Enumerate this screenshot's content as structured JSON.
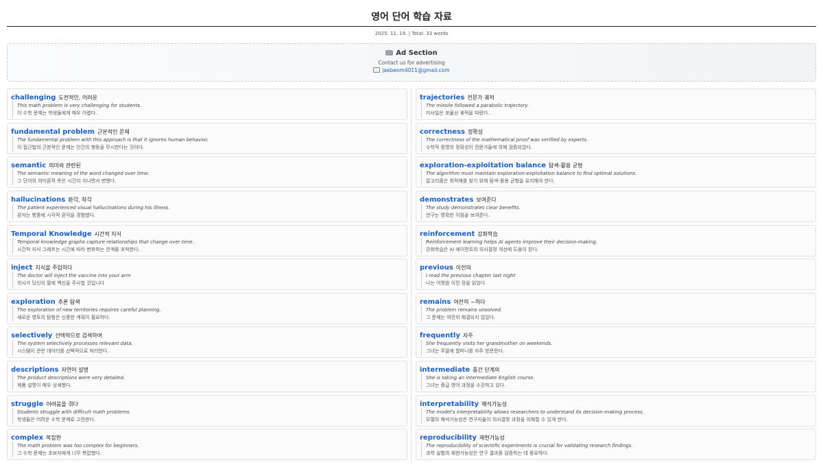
{
  "header": {
    "title": "영어 단어 학습 자료",
    "date": "2025. 11. 19.",
    "total": "Total: 33 words"
  },
  "ad": {
    "title": "Ad Section",
    "contact": "Contact us for advertising",
    "email": "jaebeom4011@gmail.com"
  },
  "left": [
    {
      "word": "challenging",
      "meaning": "도전적인, 어려운",
      "en": "This math problem is very challenging for students.",
      "ko": "이 수학 문제는 학생들에게 매우 어렵다."
    },
    {
      "word": "fundamental problem",
      "meaning": "근본적인 문제",
      "en": "The fundamental problem with this approach is that it ignores human behavior.",
      "ko": "이 접근법의 근본적인 문제는 인간의 행동을 무시한다는 것이다."
    },
    {
      "word": "semantic",
      "meaning": "의미와 관련된",
      "en": "The semantic meaning of the word changed over time.",
      "ko": "그 단어의 의미론적 뜻은 시간이 지나면서 변했다."
    },
    {
      "word": "hallucinations",
      "meaning": "환각, 착각",
      "en": "The patient experienced visual hallucinations during his illness.",
      "ko": "환자는 병중에 시각적 환각을 경험했다."
    },
    {
      "word": "Temporal Knowledge",
      "meaning": "시간적 지식",
      "en": "Temporal knowledge graphs capture relationships that change over time.",
      "ko": "시간적 지식 그래프는 시간에 따라 변화하는 관계를 포착한다."
    },
    {
      "word": "inject",
      "meaning": "지식을 주입하다",
      "en": "The doctor will inject the vaccine into your arm",
      "ko": "의사가 당신의 팔에 백신을 주사할 것입니다"
    },
    {
      "word": "exploration",
      "meaning": "추론 탐색",
      "en": "The exploration of new territories requires careful planning.",
      "ko": "새로운 영토의 탐험은 신중한 계획이 필요하다."
    },
    {
      "word": "selectively",
      "meaning": "선택적으로 검색하여",
      "en": "The system selectively processes relevant data.",
      "ko": "시스템이 관련 데이터를 선택적으로 처리한다."
    },
    {
      "word": "descriptions",
      "meaning": "자연어 설명",
      "en": "The product descriptions were very detailed.",
      "ko": "제품 설명이 매우 상세했다."
    },
    {
      "word": "struggle",
      "meaning": "어려움을 겪다",
      "en": "Students struggle with difficult math problems.",
      "ko": "학생들은 어려운 수학 문제로 고전한다."
    },
    {
      "word": "complex",
      "meaning": "복잡한",
      "en": "The math problem was too complex for beginners.",
      "ko": "그 수학 문제는 초보자에게 너무 복잡했다."
    }
  ],
  "right": [
    {
      "word": "trajectories",
      "meaning": "전문가 궤적",
      "en": "The missile followed a parabolic trajectory.",
      "ko": "미사일은 포물선 궤적을 따랐다."
    },
    {
      "word": "correctness",
      "meaning": "정확성",
      "en": "The correctness of the mathematical proof was verified by experts.",
      "ko": "수학적 증명의 정확성이 전문가들에 의해 검증되었다."
    },
    {
      "word": "exploration-exploitation balance",
      "meaning": "탐색-활용 균형",
      "en": "The algorithm must maintain exploration-exploitation balance to find optimal solutions.",
      "ko": "알고리즘은 최적해를 찾기 위해 탐색-활용 균형을 유지해야 한다."
    },
    {
      "word": "demonstrates",
      "meaning": "보여준다",
      "en": "The study demonstrates clear benefits.",
      "ko": "연구는 명확한 이점을 보여준다."
    },
    {
      "word": "reinforcement",
      "meaning": "강화학습",
      "en": "Reinforcement learning helps AI agents improve their decision-making.",
      "ko": "강화학습은 AI 에이전트의 의사결정 개선에 도움이 된다."
    },
    {
      "word": "previous",
      "meaning": "이전의",
      "en": "I read the previous chapter last night",
      "ko": "나는 어젯밤 이전 장을 읽었다"
    },
    {
      "word": "remains",
      "meaning": "여전히 ~하다",
      "en": "The problem remains unsolved.",
      "ko": "그 문제는 여전히 해결되지 않았다."
    },
    {
      "word": "frequently",
      "meaning": "자주",
      "en": "She frequently visits her grandmother on weekends.",
      "ko": "그녀는 주말에 할머니를 자주 방문한다."
    },
    {
      "word": "intermediate",
      "meaning": "중간 단계의",
      "en": "She is taking an intermediate English course.",
      "ko": "그녀는 중급 영어 과정을 수강하고 있다."
    },
    {
      "word": "interpretability",
      "meaning": "해석가능성",
      "en": "The model's interpretability allows researchers to understand its decision-making process.",
      "ko": "모델의 해석가능성은 연구자들이 의사결정 과정을 이해할 수 있게 한다."
    },
    {
      "word": "reproducibility",
      "meaning": "재현가능성",
      "en": "The reproducibility of scientific experiments is crucial for validating research findings.",
      "ko": "과학 실험의 재현가능성은 연구 결과를 검증하는 데 중요하다."
    }
  ]
}
